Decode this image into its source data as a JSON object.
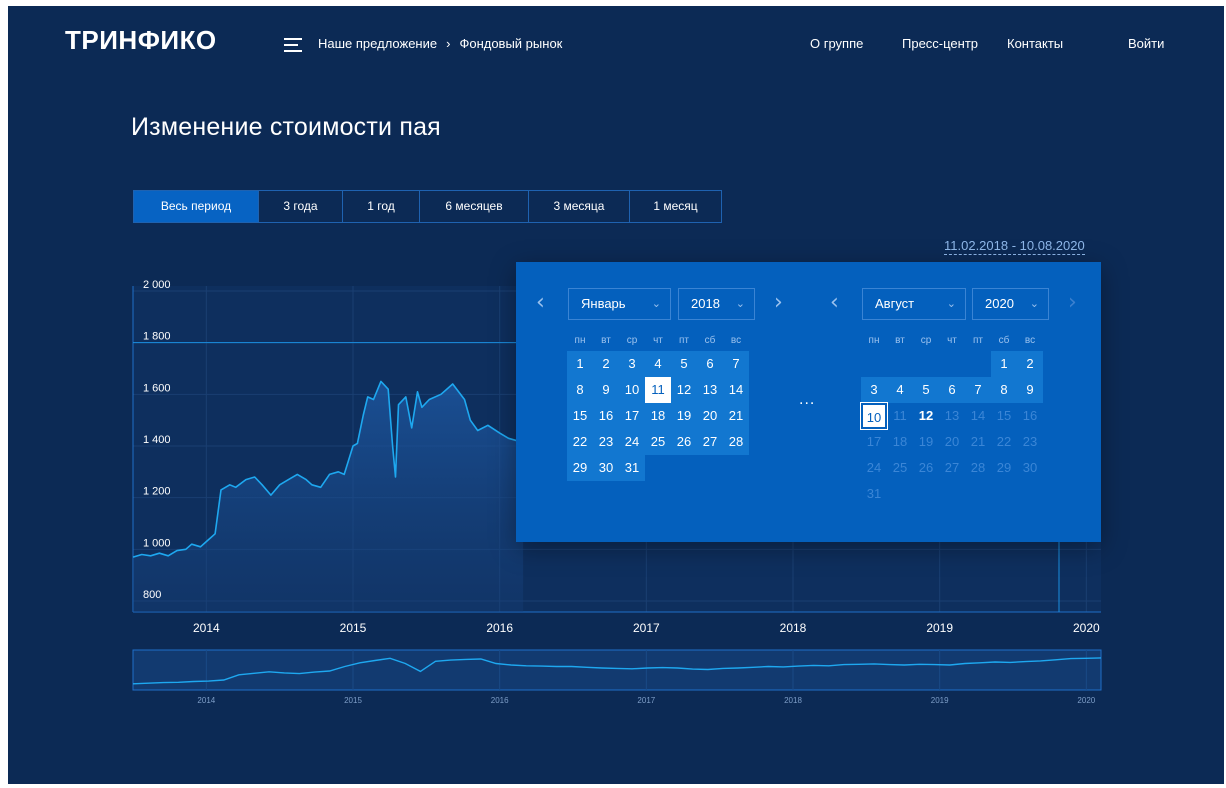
{
  "header": {
    "logo": "ТРИНФИКО",
    "breadcrumb": [
      "Наше предложение",
      "Фондовый рынок"
    ],
    "breadcrumb_sep": "›",
    "nav": [
      "О группе",
      "Пресс-центр",
      "Контакты"
    ],
    "login": "Войти"
  },
  "page": {
    "title": "Изменение стоимости пая",
    "periods": [
      "Весь период",
      "3 года",
      "1 год",
      "6 месяцев",
      "3 месяца",
      "1 месяц"
    ],
    "active_period": "Весь период",
    "date_range": "11.02.2018 - 10.08.2020"
  },
  "datepicker": {
    "left": {
      "month": "Январь",
      "year": "2018",
      "weekdays": [
        "пн",
        "вт",
        "ср",
        "чт",
        "пт",
        "сб",
        "вс"
      ],
      "first_weekday_index": 0,
      "days_in_month": 31,
      "selected_day": 11
    },
    "ellipsis": "...",
    "right": {
      "month": "Август",
      "year": "2020",
      "weekdays": [
        "пн",
        "вт",
        "ср",
        "чт",
        "пт",
        "сб",
        "вс"
      ],
      "first_weekday_index": 5,
      "days_in_month": 31,
      "selected_day": 10,
      "today": 12
    },
    "prev_icon": "chevron-left-icon",
    "next_icon": "chevron-right-icon",
    "dropdown_icon": "chevron-down-icon"
  },
  "colors": {
    "background": "#0c2a55",
    "accent": "#0763c3",
    "line": "#1ea8f0",
    "picker": "#0460bd"
  },
  "chart_data": {
    "type": "area",
    "yticks": [
      "2 000",
      "1 800",
      "1 600",
      "1 400",
      "1 200",
      "1 000",
      "800"
    ],
    "ytick_values": [
      2000,
      1800,
      1600,
      1400,
      1200,
      1000,
      800
    ],
    "ylim": [
      800,
      2000
    ],
    "xticks": [
      "2014",
      "2015",
      "2016",
      "2017",
      "2018",
      "2019",
      "2020"
    ],
    "xlim": [
      2013.5,
      2020.1
    ],
    "grid": true,
    "series": [
      {
        "x": [
          2013.5,
          2013.56,
          2013.62,
          2013.68,
          2013.74,
          2013.8,
          2013.86,
          2013.9,
          2013.96,
          2014.0,
          2014.06,
          2014.1,
          2014.16,
          2014.2,
          2014.27,
          2014.33,
          2014.38,
          2014.44,
          2014.5,
          2014.56,
          2014.62,
          2014.68,
          2014.72,
          2014.78,
          2014.84,
          2014.9,
          2014.94,
          2015.0,
          2015.03,
          2015.07,
          2015.1,
          2015.14,
          2015.19,
          2015.24,
          2015.27,
          2015.29,
          2015.31,
          2015.36,
          2015.4,
          2015.44,
          2015.47,
          2015.52,
          2015.6,
          2015.68,
          2015.76,
          2015.8,
          2015.85,
          2015.92,
          2016.0,
          2016.06,
          2016.12,
          2016.16
        ],
        "y": [
          970,
          980,
          975,
          985,
          975,
          995,
          1000,
          1020,
          1010,
          1030,
          1060,
          1230,
          1250,
          1240,
          1270,
          1280,
          1250,
          1210,
          1250,
          1270,
          1290,
          1270,
          1250,
          1240,
          1290,
          1300,
          1290,
          1400,
          1410,
          1520,
          1590,
          1580,
          1650,
          1620,
          1400,
          1280,
          1560,
          1590,
          1470,
          1610,
          1550,
          1580,
          1600,
          1640,
          1580,
          1500,
          1460,
          1480,
          1450,
          1430,
          1420,
          1420
        ]
      }
    ],
    "mini_xticks": [
      "2014",
      "2015",
      "2016",
      "2017",
      "2018",
      "2019",
      "2020"
    ],
    "mini_series": [
      960,
      975,
      990,
      1000,
      1020,
      1030,
      1060,
      1200,
      1240,
      1280,
      1250,
      1230,
      1270,
      1300,
      1420,
      1520,
      1580,
      1640,
      1500,
      1290,
      1560,
      1590,
      1610,
      1620,
      1500,
      1460,
      1440,
      1430,
      1420,
      1420,
      1400,
      1380,
      1370,
      1360,
      1380,
      1390,
      1380,
      1350,
      1340,
      1370,
      1380,
      1400,
      1420,
      1410,
      1430,
      1450,
      1440,
      1470,
      1480,
      1490,
      1470,
      1460,
      1480,
      1470,
      1460,
      1500,
      1520,
      1540,
      1530,
      1550,
      1570,
      1600,
      1630,
      1640,
      1650
    ]
  }
}
